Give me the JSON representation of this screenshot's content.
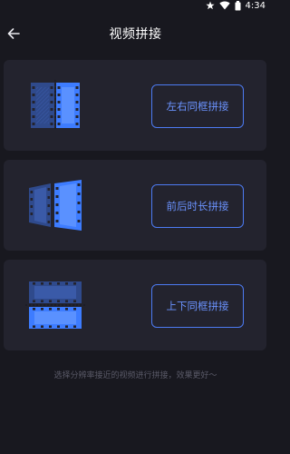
{
  "status_bar": {
    "time": "4:34"
  },
  "header": {
    "title": "视频拼接"
  },
  "options": [
    {
      "id": "side-by-side",
      "label": "左右同框拼接"
    },
    {
      "id": "timeline",
      "label": "前后时长拼接"
    },
    {
      "id": "top-bottom",
      "label": "上下同框拼接"
    }
  ],
  "footer": {
    "hint": "选择分辨率接近的视频进行拼接，效果更好～"
  },
  "colors": {
    "accent": "#4d7bf3",
    "bright": "#3d7cff",
    "dim": "#2f4a8c",
    "card": "#23232e",
    "background": "#18181f"
  }
}
